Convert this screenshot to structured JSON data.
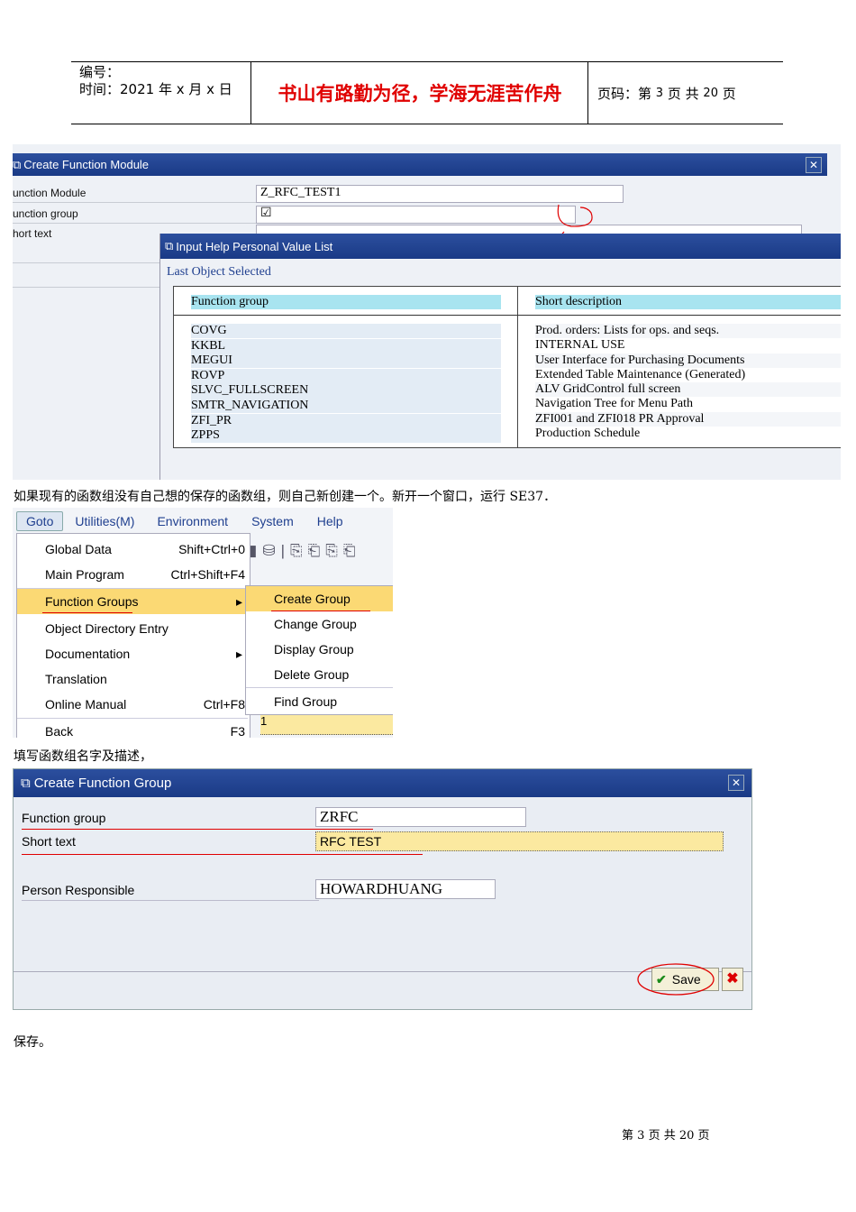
{
  "header": {
    "number_label": "编号：",
    "time_label": "时间：2021 年 x 月 x 日",
    "motto": "书山有路勤为径，学海无涯苦作舟",
    "page_label": "页码：第",
    "page_num": "3",
    "page_mid": "页  共",
    "page_total": "20",
    "page_end": "页"
  },
  "shot1": {
    "title": "Create Function Module",
    "labels": [
      "unction Module",
      "unction group",
      "hort text"
    ],
    "function_module_value": "Z_RFC_TEST1",
    "popup_title": "Input Help Personal Value List",
    "section": "Last Object Selected",
    "col1": "Function group",
    "col2": "Short description",
    "rows": [
      {
        "group": "COVG",
        "desc": "Prod. orders: Lists for ops. and seqs."
      },
      {
        "group": "KKBL",
        "desc": "INTERNAL USE"
      },
      {
        "group": "MEGUI",
        "desc": "User Interface for Purchasing Documents"
      },
      {
        "group": "ROVP",
        "desc": "Extended Table Maintenance (Generated)"
      },
      {
        "group": "SLVC_FULLSCREEN",
        "desc": "ALV GridControl full screen"
      },
      {
        "group": "SMTR_NAVIGATION",
        "desc": "Navigation Tree for Menu Path"
      },
      {
        "group": "ZFI_PR",
        "desc": "ZFI001 and ZFI018 PR Approval"
      },
      {
        "group": "ZPPS",
        "desc": "Production Schedule"
      }
    ]
  },
  "caption1": "如果现有的函数组没有自己想的保存的函数组，则自己新创建一个。新开一个窗口，运行 SE37．",
  "shot2": {
    "menubar": [
      "Goto",
      "Utilities(M)",
      "Environment",
      "System",
      "Help"
    ],
    "menu": [
      {
        "label": "Global Data",
        "shortcut": "Shift+Ctrl+0"
      },
      {
        "label": "Main Program",
        "shortcut": "Ctrl+Shift+F4"
      },
      {
        "label": "Function Groups",
        "shortcut": ""
      },
      {
        "label": "Object Directory Entry",
        "shortcut": ""
      },
      {
        "label": "Documentation",
        "shortcut": ""
      },
      {
        "label": "Translation",
        "shortcut": ""
      },
      {
        "label": "Online Manual",
        "shortcut": "Ctrl+F8"
      },
      {
        "label": "Back",
        "shortcut": "F3"
      }
    ],
    "submenu": [
      "Create Group",
      "Change Group",
      "Display Group",
      "Delete Group",
      "Find Group"
    ]
  },
  "caption2": "填写函数组名字及描述，",
  "shot3": {
    "title": "Create Function Group",
    "function_group_label": "Function group",
    "function_group_value": "ZRFC",
    "short_text_label": "Short text",
    "short_text_value": "RFC TEST",
    "person_label": "Person Responsible",
    "person_value": "HOWARDHUANG",
    "save_label": "Save"
  },
  "caption3": "保存。",
  "footer": {
    "a": "第",
    "page": "3",
    "b": "页  共",
    "total": "20",
    "c": "页"
  },
  "colors": {
    "titlebar": "#1f418f",
    "highlight": "#fbd974",
    "annotation": "#e00000",
    "col_header": "#a8e4f0"
  }
}
